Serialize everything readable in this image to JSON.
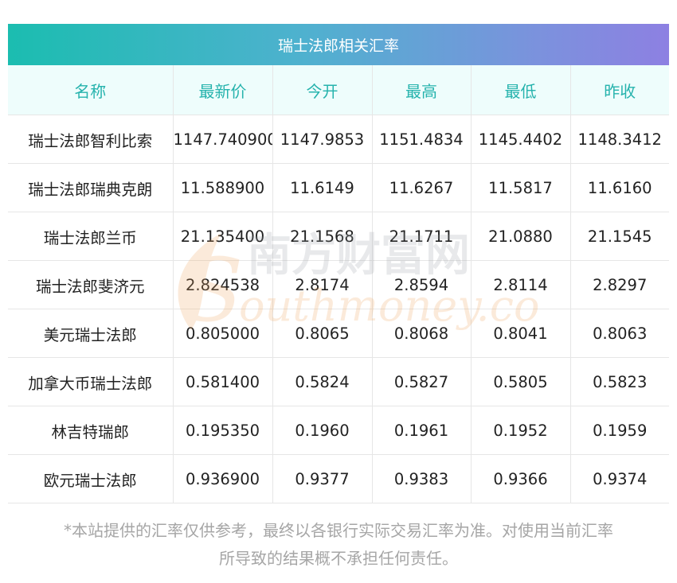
{
  "title": "瑞士法郎相关汇率",
  "columns": [
    "名称",
    "最新价",
    "今开",
    "最高",
    "最低",
    "昨收"
  ],
  "rows": [
    [
      "瑞士法郎智利比索",
      "1147.740900",
      "1147.9853",
      "1151.4834",
      "1145.4402",
      "1148.3412"
    ],
    [
      "瑞士法郎瑞典克朗",
      "11.588900",
      "11.6149",
      "11.6267",
      "11.5817",
      "11.6160"
    ],
    [
      "瑞士法郎兰币",
      "21.135400",
      "21.1568",
      "21.1711",
      "21.0880",
      "21.1545"
    ],
    [
      "瑞士法郎斐济元",
      "2.824538",
      "2.8174",
      "2.8594",
      "2.8114",
      "2.8297"
    ],
    [
      "美元瑞士法郎",
      "0.805000",
      "0.8065",
      "0.8068",
      "0.8041",
      "0.8063"
    ],
    [
      "加拿大币瑞士法郎",
      "0.581400",
      "0.5824",
      "0.5827",
      "0.5805",
      "0.5823"
    ],
    [
      "林吉特瑞郎",
      "0.195350",
      "0.1960",
      "0.1961",
      "0.1952",
      "0.1959"
    ],
    [
      "欧元瑞士法郎",
      "0.936900",
      "0.9377",
      "0.9383",
      "0.9366",
      "0.9374"
    ]
  ],
  "watermark": {
    "cn_text": "南方财富网",
    "en_text": "outhmoney.com",
    "logo_letter": "S"
  },
  "footnote": {
    "line1": "*本站提供的汇率仅供参考，最终以各银行实际交易汇率为准。对使用当前汇率",
    "line2": "所导致的结果概不承担任何责任。"
  },
  "colors": {
    "header_gradient_start": "#1bbdb0",
    "header_gradient_end": "#8d80e2",
    "column_header_bg": "#eefdfc",
    "column_header_text": "#26b3ad",
    "footnote_text": "#a6a6a6",
    "watermark_orange": "#f0a35a"
  }
}
